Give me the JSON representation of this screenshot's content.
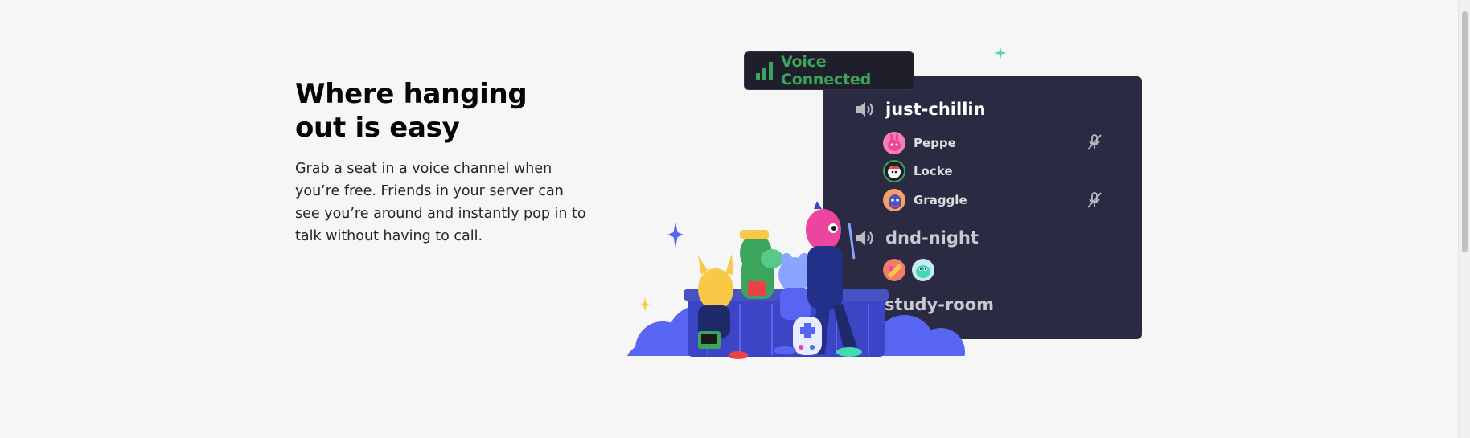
{
  "section": {
    "headline": "Where hanging out is easy",
    "body": "Grab a seat in a voice channel when you’re free. Friends in your server can see you’re around and instantly pop in to talk without having to call."
  },
  "voice_badge": {
    "label": "Voice Connected",
    "icon": "signal-bars-icon",
    "color": "#3ba55d"
  },
  "channels": [
    {
      "name": "just-chillin",
      "icon": "speaker-icon",
      "users": [
        {
          "name": "Peppe",
          "muted": true
        },
        {
          "name": "Locke",
          "muted": false
        },
        {
          "name": "Graggle",
          "muted": true
        }
      ]
    },
    {
      "name": "dnd-night",
      "icon": "speaker-icon",
      "avatars_only": 2
    },
    {
      "name": "study-room"
    }
  ],
  "colors": {
    "panel_bg": "#2a2a43",
    "badge_bg": "#1f1f2b",
    "page_bg": "#f6f6f6",
    "accent_blurple": "#5865f2"
  }
}
